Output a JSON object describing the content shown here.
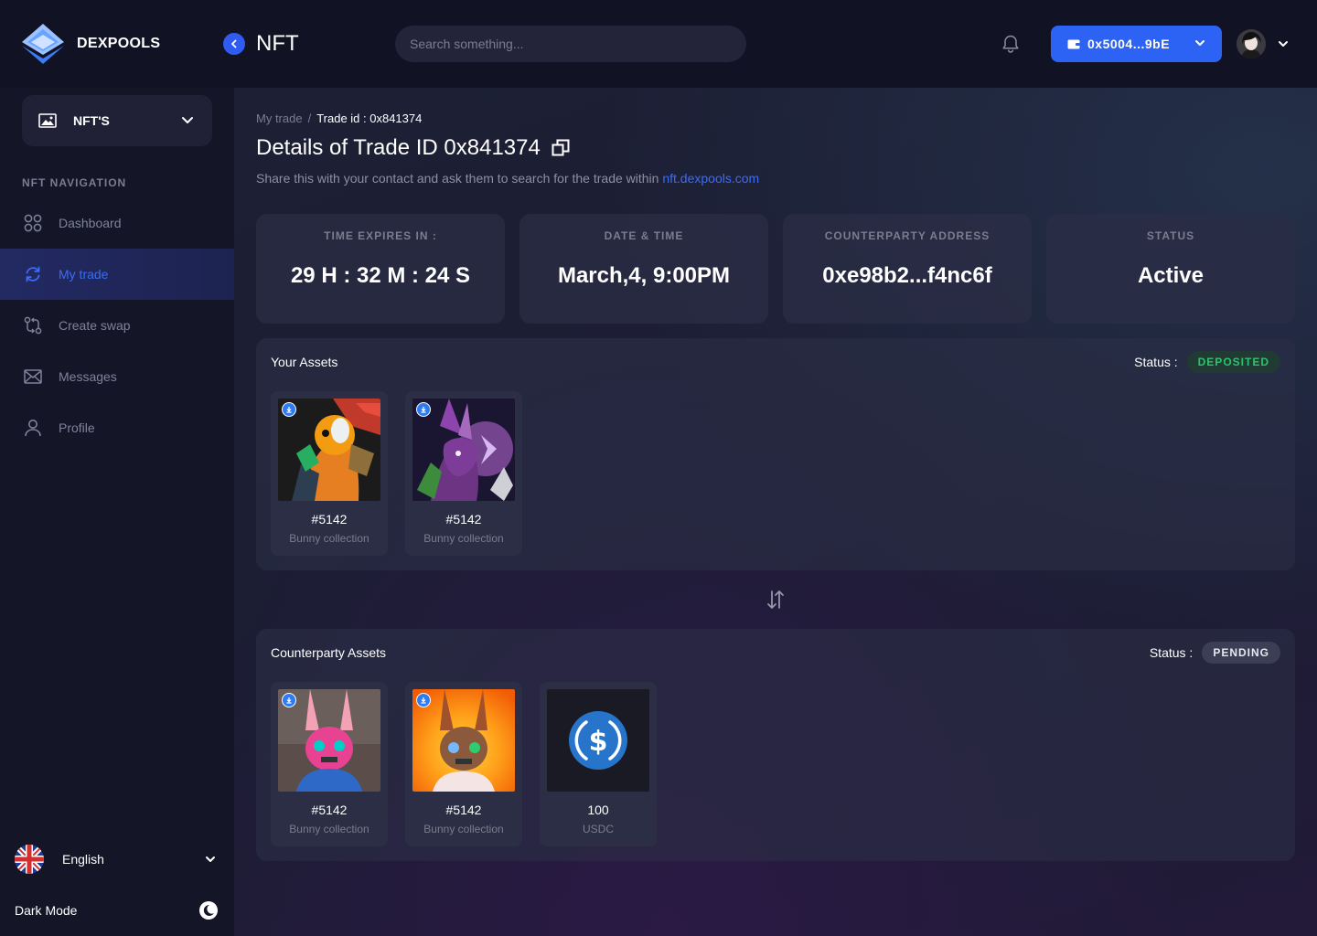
{
  "brand": {
    "name": "DEXPOOLS"
  },
  "header": {
    "page_title": "NFT",
    "search_placeholder": "Search something...",
    "wallet_address": "0x5004...9bE"
  },
  "sidebar": {
    "selector_label": "NFT'S",
    "nav_title": "NFT NAVIGATION",
    "items": [
      {
        "label": "Dashboard",
        "icon": "dashboard-icon",
        "active": false
      },
      {
        "label": "My trade",
        "icon": "refresh-icon",
        "active": true
      },
      {
        "label": "Create swap",
        "icon": "swap-icon",
        "active": false
      },
      {
        "label": "Messages",
        "icon": "mail-icon",
        "active": false
      },
      {
        "label": "Profile",
        "icon": "user-icon",
        "active": false
      }
    ],
    "language": "English",
    "dark_mode_label": "Dark Mode"
  },
  "main": {
    "breadcrumb": {
      "parent": "My trade",
      "separator": "/",
      "current": "Trade id : 0x841374"
    },
    "title": "Details of Trade ID 0x841374",
    "subtitle": "Share this with your contact and ask them to search for the trade within",
    "subtitle_link": "nft.dexpools.com",
    "stats": [
      {
        "label": "TIME EXPIRES IN :",
        "value": "29 H : 32 M : 24 S"
      },
      {
        "label": "DATE & TIME",
        "value": "March,4, 9:00PM"
      },
      {
        "label": "COUNTERPARTY ADDRESS",
        "value": "0xe98b2...f4nc6f"
      },
      {
        "label": "STATUS",
        "value": "Active"
      }
    ],
    "your_assets": {
      "title": "Your Assets",
      "status_label": "Status :",
      "status": "DEPOSITED",
      "items": [
        {
          "name": "#5142",
          "collection": "Bunny collection"
        },
        {
          "name": "#5142",
          "collection": "Bunny collection"
        }
      ]
    },
    "counterparty_assets": {
      "title": "Counterparty Assets",
      "status_label": "Status :",
      "status": "PENDING",
      "items": [
        {
          "name": "#5142",
          "collection": "Bunny collection"
        },
        {
          "name": "#5142",
          "collection": "Bunny collection"
        },
        {
          "name": "100",
          "collection": "USDC"
        }
      ]
    }
  },
  "colors": {
    "accent": "#2c63f5",
    "deposited": "#2cc36b",
    "sidebar_bg": "#151528"
  }
}
